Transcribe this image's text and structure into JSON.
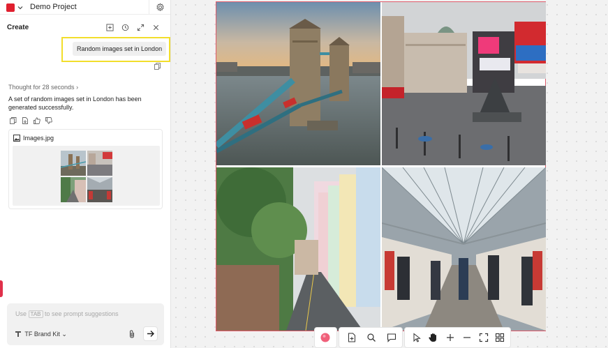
{
  "app": {
    "project_name": "Demo Project"
  },
  "panel": {
    "title": "Create"
  },
  "chat": {
    "user_message": "Random images set in London",
    "thought": "Thought for 28 seconds",
    "thought_chevron": "›",
    "assistant_reply": "A set of random images set in London has been generated successfully.",
    "attachment": {
      "file_name": "Images.jpg"
    }
  },
  "prompt": {
    "hint_prefix": "Use",
    "hint_key": "TAB",
    "hint_suffix": "to see prompt suggestions",
    "brand_kit_label": "TF Brand Kit",
    "brand_kit_chevron": "⌄"
  },
  "canvas": {
    "images": [
      {
        "name": "tower-bridge"
      },
      {
        "name": "piccadilly-circus"
      },
      {
        "name": "pastel-street"
      },
      {
        "name": "train-station"
      }
    ]
  },
  "icons": {
    "top": [
      "chevron-down-icon",
      "gear-icon"
    ],
    "header": [
      "add-frame-icon",
      "history-icon",
      "expand-icon",
      "close-icon"
    ],
    "actions": [
      "copy-icon",
      "export-icon",
      "thumbs-up-icon",
      "thumbs-down-icon"
    ],
    "toolbar": [
      "color-swatch-icon",
      "add-image-icon",
      "search-icon",
      "comment-icon",
      "pointer-icon",
      "hand-icon",
      "zoom-in-icon",
      "zoom-out-icon",
      "fit-screen-icon",
      "grid-icon"
    ]
  },
  "colors": {
    "brand": "#e0202f",
    "highlight": "#f2de2c",
    "selection": "#e05a6a",
    "swatch": "#f0607a"
  }
}
